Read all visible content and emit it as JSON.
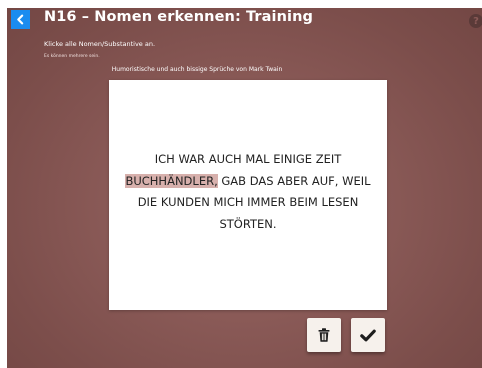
{
  "header": {
    "title": "N16 – Nomen erkennen: Training",
    "back_icon": "chevron-left-icon",
    "help_label": "?"
  },
  "task": {
    "instruction": "Klicke alle Nomen/Substantive an.",
    "hint": "Es können mehrere sein.",
    "subtitle": "Humoristische und auch bissige Sprüche von Mark Twain"
  },
  "quote": {
    "lines": [
      [
        {
          "text": "ICH",
          "selected": false
        },
        {
          "text": "WAR",
          "selected": false
        },
        {
          "text": "AUCH",
          "selected": false
        },
        {
          "text": "MAL",
          "selected": false
        },
        {
          "text": "EINIGE",
          "selected": false
        },
        {
          "text": "ZEIT",
          "selected": false
        }
      ],
      [
        {
          "text": "BUCHHÄNDLER,",
          "selected": true
        },
        {
          "text": "GAB",
          "selected": false
        },
        {
          "text": "DAS",
          "selected": false
        },
        {
          "text": "ABER",
          "selected": false
        },
        {
          "text": "AUF,",
          "selected": false
        },
        {
          "text": "WEIL",
          "selected": false
        }
      ],
      [
        {
          "text": "DIE",
          "selected": false
        },
        {
          "text": "KUNDEN",
          "selected": false
        },
        {
          "text": "MICH",
          "selected": false
        },
        {
          "text": "IMMER",
          "selected": false
        },
        {
          "text": "BEIM",
          "selected": false
        },
        {
          "text": "LESEN",
          "selected": false
        }
      ],
      [
        {
          "text": "STÖRTEN.",
          "selected": false
        }
      ]
    ]
  },
  "actions": {
    "delete_icon": "trash-icon",
    "submit_icon": "checkmark-icon"
  },
  "colors": {
    "background": "#8a5a57",
    "accent": "#1a8cf0",
    "selection": "#d7b0ac",
    "card": "#ffffff"
  }
}
